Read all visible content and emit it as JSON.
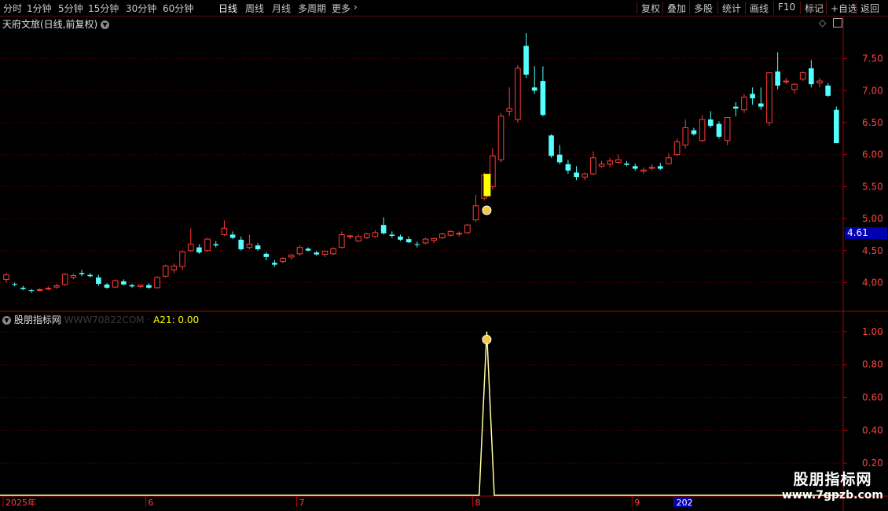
{
  "toolbar": {
    "left": [
      "分时",
      "1分钟",
      "5分钟",
      "15分钟",
      "30分钟",
      "60分钟",
      "日线",
      "周线",
      "月线",
      "多周期",
      "更多"
    ],
    "active": "日线",
    "right": [
      "复权",
      "叠加",
      "多股",
      "统计",
      "画线",
      "F10",
      "标记",
      "+自选",
      "返回"
    ]
  },
  "main_title": "天府文旅(日线,前复权)",
  "indicator": {
    "name": "股朋指标网",
    "site": "WWW70822COM",
    "value_label": "A21: 0.00"
  },
  "price_tag": "4.61",
  "watermark": {
    "line1": "股朋指标网",
    "line2": "www.7gpzb.com"
  },
  "colors": {
    "up": "#ff3b3b",
    "down": "#54ffff",
    "grid": "#7a0000",
    "signal": "#ffff00",
    "axis": "#b00000"
  },
  "chart_data": [
    {
      "type": "candlestick",
      "title": "天府文旅(日线,前复权)",
      "ylim": [
        3.6,
        7.95
      ],
      "y_ticks": [
        4.0,
        4.5,
        5.0,
        5.5,
        6.0,
        6.5,
        7.0,
        7.5
      ],
      "x_labels": [
        "2025年",
        "6",
        "7",
        "8",
        "9",
        "202"
      ],
      "x_label_index": [
        0,
        17,
        35,
        56,
        75,
        80
      ],
      "ohlc": [
        [
          4.05,
          4.15,
          4.0,
          4.12
        ],
        [
          3.98,
          4.0,
          3.94,
          3.97
        ],
        [
          3.92,
          3.95,
          3.88,
          3.9
        ],
        [
          3.88,
          3.9,
          3.84,
          3.87
        ],
        [
          3.88,
          3.91,
          3.86,
          3.89
        ],
        [
          3.9,
          3.94,
          3.88,
          3.91
        ],
        [
          3.93,
          3.98,
          3.9,
          3.95
        ],
        [
          3.97,
          4.15,
          3.95,
          4.13
        ],
        [
          4.08,
          4.14,
          4.05,
          4.11
        ],
        [
          4.15,
          4.2,
          4.1,
          4.13
        ],
        [
          4.12,
          4.15,
          4.08,
          4.1
        ],
        [
          4.08,
          4.12,
          3.95,
          3.98
        ],
        [
          3.97,
          3.99,
          3.9,
          3.92
        ],
        [
          3.93,
          4.05,
          3.92,
          4.03
        ],
        [
          4.02,
          4.05,
          3.96,
          3.97
        ],
        [
          3.96,
          3.98,
          3.92,
          3.94
        ],
        [
          3.94,
          3.97,
          3.91,
          3.96
        ],
        [
          3.96,
          3.99,
          3.9,
          3.92
        ],
        [
          3.92,
          4.1,
          3.91,
          4.08
        ],
        [
          4.1,
          4.28,
          4.08,
          4.26
        ],
        [
          4.2,
          4.3,
          4.15,
          4.26
        ],
        [
          4.25,
          4.5,
          4.2,
          4.48
        ],
        [
          4.5,
          4.85,
          4.48,
          4.6
        ],
        [
          4.55,
          4.6,
          4.45,
          4.47
        ],
        [
          4.5,
          4.7,
          4.48,
          4.68
        ],
        [
          4.6,
          4.65,
          4.55,
          4.58
        ],
        [
          4.75,
          4.97,
          4.73,
          4.85
        ],
        [
          4.75,
          4.8,
          4.68,
          4.7
        ],
        [
          4.67,
          4.72,
          4.5,
          4.52
        ],
        [
          4.55,
          4.75,
          4.52,
          4.6
        ],
        [
          4.58,
          4.62,
          4.5,
          4.52
        ],
        [
          4.45,
          4.48,
          4.35,
          4.4
        ],
        [
          4.31,
          4.35,
          4.25,
          4.28
        ],
        [
          4.33,
          4.4,
          4.3,
          4.38
        ],
        [
          4.4,
          4.45,
          4.36,
          4.43
        ],
        [
          4.45,
          4.58,
          4.42,
          4.55
        ],
        [
          4.53,
          4.55,
          4.49,
          4.5
        ],
        [
          4.47,
          4.5,
          4.42,
          4.44
        ],
        [
          4.44,
          4.5,
          4.4,
          4.49
        ],
        [
          4.45,
          4.55,
          4.43,
          4.53
        ],
        [
          4.55,
          4.8,
          4.53,
          4.75
        ],
        [
          4.72,
          4.75,
          4.68,
          4.73
        ],
        [
          4.65,
          4.75,
          4.63,
          4.72
        ],
        [
          4.7,
          4.78,
          4.68,
          4.76
        ],
        [
          4.72,
          4.82,
          4.7,
          4.78
        ],
        [
          4.9,
          5.02,
          4.75,
          4.77
        ],
        [
          4.75,
          4.8,
          4.7,
          4.73
        ],
        [
          4.72,
          4.75,
          4.65,
          4.67
        ],
        [
          4.68,
          4.72,
          4.62,
          4.63
        ],
        [
          4.6,
          4.64,
          4.55,
          4.59
        ],
        [
          4.62,
          4.7,
          4.6,
          4.68
        ],
        [
          4.66,
          4.7,
          4.62,
          4.69
        ],
        [
          4.7,
          4.78,
          4.68,
          4.76
        ],
        [
          4.74,
          4.82,
          4.72,
          4.8
        ],
        [
          4.76,
          4.8,
          4.72,
          4.77
        ],
        [
          4.78,
          4.92,
          4.76,
          4.9
        ],
        [
          4.98,
          5.37,
          4.95,
          5.2
        ],
        [
          5.32,
          5.72,
          5.28,
          5.68
        ],
        [
          5.5,
          6.1,
          5.45,
          5.98
        ],
        [
          5.92,
          6.65,
          5.88,
          6.6
        ],
        [
          6.68,
          7.05,
          6.6,
          6.72
        ],
        [
          6.55,
          7.4,
          6.5,
          7.35
        ],
        [
          7.7,
          7.9,
          7.2,
          7.25
        ],
        [
          7.05,
          7.38,
          6.95,
          7.0
        ],
        [
          7.15,
          7.38,
          6.6,
          6.62
        ],
        [
          6.3,
          6.32,
          5.95,
          5.98
        ],
        [
          6.0,
          6.15,
          5.85,
          5.88
        ],
        [
          5.85,
          5.92,
          5.7,
          5.75
        ],
        [
          5.72,
          5.82,
          5.6,
          5.65
        ],
        [
          5.65,
          5.72,
          5.6,
          5.7
        ],
        [
          5.7,
          6.05,
          5.68,
          5.95
        ],
        [
          5.82,
          5.9,
          5.8,
          5.85
        ],
        [
          5.85,
          5.95,
          5.8,
          5.9
        ],
        [
          5.88,
          6.0,
          5.85,
          5.92
        ],
        [
          5.86,
          5.9,
          5.82,
          5.84
        ],
        [
          5.82,
          5.86,
          5.75,
          5.78
        ],
        [
          5.74,
          5.8,
          5.7,
          5.76
        ],
        [
          5.8,
          5.85,
          5.75,
          5.8
        ],
        [
          5.82,
          5.87,
          5.76,
          5.78
        ],
        [
          5.86,
          6.02,
          5.84,
          5.95
        ],
        [
          6.0,
          6.25,
          5.98,
          6.2
        ],
        [
          6.15,
          6.55,
          6.1,
          6.42
        ],
        [
          6.38,
          6.42,
          6.3,
          6.32
        ],
        [
          6.22,
          6.62,
          6.2,
          6.55
        ],
        [
          6.55,
          6.68,
          6.42,
          6.45
        ],
        [
          6.48,
          6.52,
          6.25,
          6.28
        ],
        [
          6.22,
          6.55,
          6.15,
          6.58
        ],
        [
          6.75,
          6.82,
          6.6,
          6.72
        ],
        [
          6.7,
          6.95,
          6.65,
          6.9
        ],
        [
          6.95,
          7.05,
          6.78,
          6.88
        ],
        [
          6.8,
          7.05,
          6.7,
          6.75
        ],
        [
          6.5,
          7.28,
          6.45,
          7.28
        ],
        [
          7.3,
          7.6,
          7.02,
          7.08
        ],
        [
          7.15,
          7.2,
          7.1,
          7.15
        ],
        [
          7.02,
          7.12,
          6.95,
          7.1
        ],
        [
          7.18,
          7.3,
          7.15,
          7.28
        ],
        [
          7.35,
          7.48,
          7.05,
          7.1
        ],
        [
          7.12,
          7.2,
          7.05,
          7.15
        ],
        [
          7.08,
          7.12,
          6.9,
          6.92
        ],
        [
          6.7,
          6.75,
          6.18,
          6.18
        ]
      ],
      "signal_index": 57,
      "signal_bar": [
        5.35,
        5.7
      ]
    },
    {
      "type": "line",
      "series": [
        {
          "name": "A21",
          "peak_index": 57,
          "peak_value": 1.0,
          "baseline": 0
        }
      ],
      "ylim": [
        0,
        1.1
      ],
      "y_ticks": [
        0.2,
        0.4,
        0.6,
        0.8,
        1.0
      ]
    }
  ]
}
